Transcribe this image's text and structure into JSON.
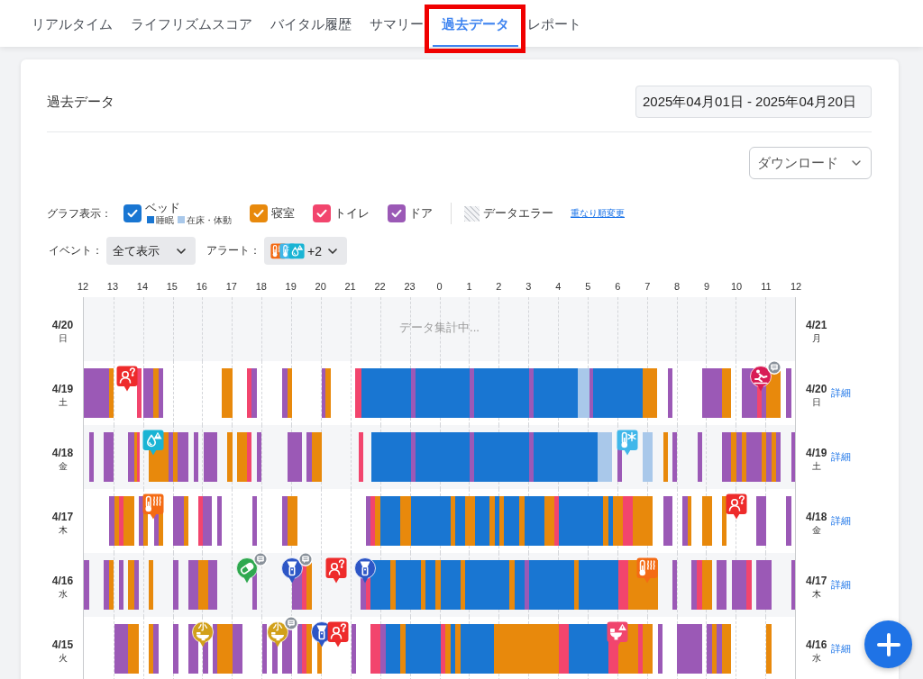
{
  "tabs": [
    {
      "label": "リアルタイム",
      "selected": false,
      "highlighted": false
    },
    {
      "label": "ライフリズムスコア",
      "selected": false,
      "highlighted": false
    },
    {
      "label": "バイタル履歴",
      "selected": false,
      "highlighted": false
    },
    {
      "label": "サマリー",
      "selected": false,
      "highlighted": false
    },
    {
      "label": "過去データ",
      "selected": true,
      "highlighted": true
    },
    {
      "label": "レポート",
      "selected": false,
      "highlighted": false
    }
  ],
  "card": {
    "title": "過去データ",
    "date_range": "2025年04月01日 - 2025年04月20日",
    "download_button": "ダウンロード"
  },
  "legend": {
    "title": "グラフ表示：",
    "items": [
      {
        "kind": "bed",
        "label": "ベッド",
        "checked": true,
        "color": "#1976d2",
        "sub": [
          {
            "kind": "sleep",
            "label": "睡眠",
            "color": "#1976d2"
          },
          {
            "kind": "in_bed",
            "label": "在床・体動",
            "color": "#a9c8ea"
          }
        ]
      },
      {
        "kind": "bedroom",
        "label": "寝室",
        "checked": true,
        "color": "#e8890c"
      },
      {
        "kind": "toilet",
        "label": "トイレ",
        "checked": true,
        "color": "#f2456d"
      },
      {
        "kind": "door",
        "label": "ドア",
        "checked": true,
        "color": "#9b59b6"
      }
    ],
    "error_label": "データエラー",
    "order_link": "重なり順変更"
  },
  "filters": {
    "event_label": "イベント：",
    "event_value": "全て表示",
    "alert_label": "アラート：",
    "alert_icons": [
      {
        "kind": "thermometer-heat"
      },
      {
        "kind": "thermometer-cold"
      },
      {
        "kind": "drop-alert"
      }
    ],
    "alert_more": "+2"
  },
  "timeline": {
    "hours": [
      "12",
      "13",
      "14",
      "15",
      "16",
      "17",
      "18",
      "19",
      "20",
      "21",
      "22",
      "23",
      "0",
      "1",
      "2",
      "3",
      "4",
      "5",
      "6",
      "7",
      "8",
      "9",
      "10",
      "11",
      "12"
    ],
    "rows": [
      {
        "date": "4/20",
        "weekday": "日",
        "end_date": "4/21",
        "end_weekday": "月",
        "status": "データ集計中..."
      },
      {
        "date": "4/19",
        "weekday": "土",
        "end_date": "4/20",
        "end_weekday": "日",
        "detail_link": "詳細",
        "markers": [
          {
            "kind": "person-question",
            "comment": false
          },
          {
            "kind": "fall",
            "comment": true
          }
        ]
      },
      {
        "date": "4/18",
        "weekday": "金",
        "end_date": "4/19",
        "end_weekday": "土",
        "detail_link": "詳細",
        "markers": [
          {
            "kind": "drop-alert",
            "comment": false
          },
          {
            "kind": "thermometer-cold",
            "comment": false
          }
        ]
      },
      {
        "date": "4/17",
        "weekday": "木",
        "end_date": "4/18",
        "end_weekday": "金",
        "detail_link": "詳細",
        "markers": [
          {
            "kind": "thermometer-heat",
            "comment": false
          },
          {
            "kind": "person-question",
            "comment": false
          }
        ]
      },
      {
        "date": "4/16",
        "weekday": "水",
        "end_date": "4/17",
        "end_weekday": "木",
        "detail_link": "詳細",
        "markers": [
          {
            "kind": "pill",
            "comment": true
          },
          {
            "kind": "flashlight",
            "comment": true
          },
          {
            "kind": "person-question",
            "comment": false
          },
          {
            "kind": "flashlight",
            "comment": false
          },
          {
            "kind": "thermometer-heat",
            "comment": false
          }
        ]
      },
      {
        "date": "4/15",
        "weekday": "火",
        "end_date": "4/16",
        "end_weekday": "水",
        "detail_link": "詳細",
        "markers": [
          {
            "kind": "toilet-urine",
            "label": "小",
            "comment": false
          },
          {
            "kind": "toilet-urine",
            "label": "小",
            "comment": true
          },
          {
            "kind": "flashlight",
            "comment": false
          },
          {
            "kind": "person-question",
            "comment": false
          },
          {
            "kind": "toilet-alert",
            "comment": false
          }
        ]
      }
    ]
  }
}
